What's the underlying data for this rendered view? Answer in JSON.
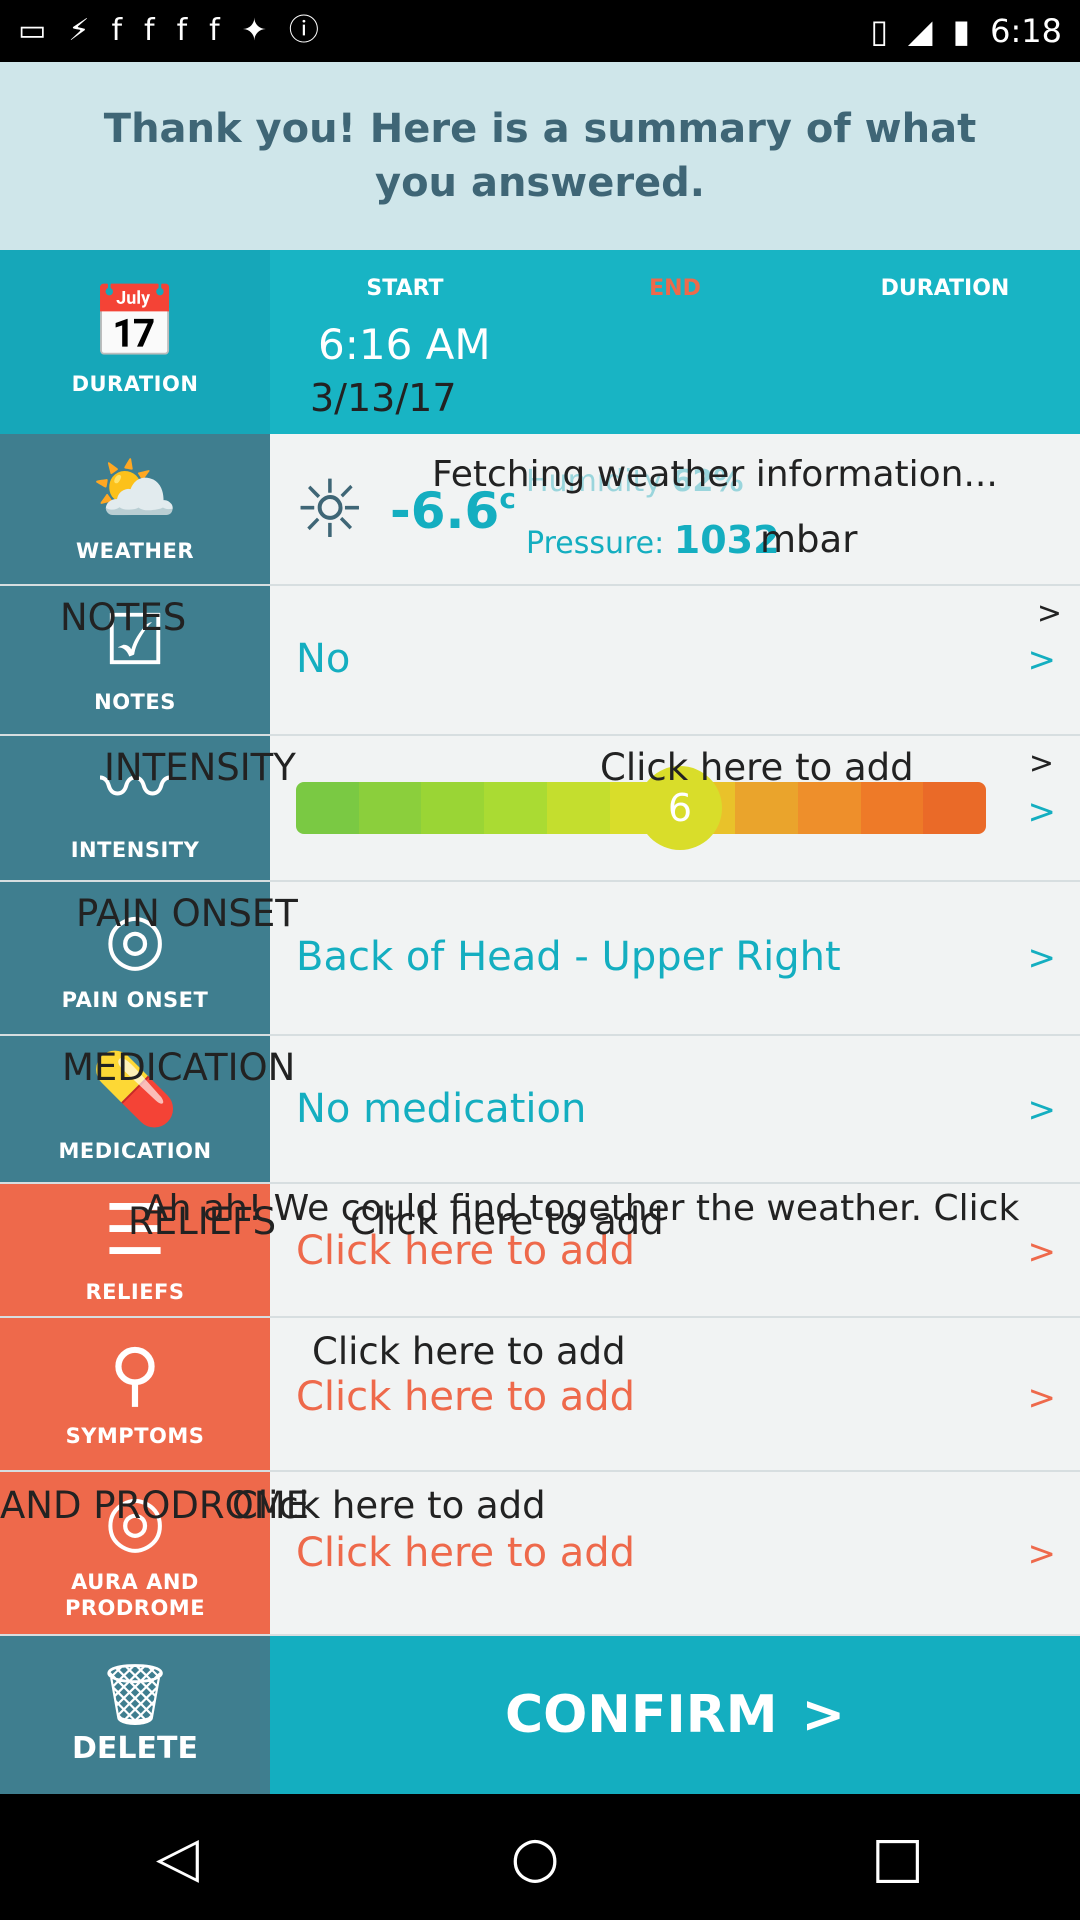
{
  "status": {
    "time": "6:18",
    "left_icons": [
      "message-icon",
      "flash-icon",
      "facebook-icon",
      "facebook-icon",
      "facebook-icon",
      "facebook-icon",
      "satellite-icon",
      "info-icon"
    ],
    "right_icons": [
      "vibrate-icon",
      "signal-icon",
      "battery-icon"
    ]
  },
  "header": {
    "title": "Thank you! Here is a summary of what you answered."
  },
  "duration": {
    "label": "DURATION",
    "col_start": "START",
    "col_end": "END",
    "col_duration": "DURATION",
    "start_time": "6:16 AM",
    "start_date": "3/13/17"
  },
  "weather": {
    "label": "WEATHER",
    "fetching": "Fetching weather information...",
    "temp": "-6.6",
    "temp_unit": "c",
    "humidity_label": "Humidity",
    "humidity_value": "62%",
    "pressure_label": "Pressure:",
    "pressure_value": "1032",
    "pressure_unit": "mbar"
  },
  "notes": {
    "label": "NOTES",
    "overlay_label": "NOTES",
    "value": "No"
  },
  "intensity": {
    "label": "INTENSITY",
    "overlay_label": "INTENSITY",
    "overlay_add": "Click here to add",
    "value": 6,
    "colors": [
      "#7ac943",
      "#8bcf3c",
      "#9ad535",
      "#aadb33",
      "#c4de2e",
      "#d9dd2a",
      "#e9c22a",
      "#eaa42c",
      "#ee8f2b",
      "#ee7a28",
      "#ea6a28"
    ]
  },
  "onset": {
    "label": "PAIN ONSET",
    "overlay_label": "PAIN ONSET",
    "value": "Back of Head - Upper Right"
  },
  "medication": {
    "label": "MEDICATION",
    "overlay_label": "MEDICATION",
    "value": "No medication"
  },
  "reliefs": {
    "label": "RELIEFS",
    "overlay_label": "RELIEFS",
    "overlay_msg": "Ah ah! We could find together the weather. Click",
    "overlay_add": "Click here to add",
    "value": "Click here to add"
  },
  "symptoms": {
    "label": "SYMPTOMS",
    "overlay_add": "Click here to add",
    "value": "Click here to add"
  },
  "aura": {
    "label": "AURA AND PRODROME",
    "label_line1": "AURA AND",
    "label_line2": "PRODROME",
    "overlay_label": "AND PRODROME",
    "overlay_add": "Click here to add",
    "value": "Click here to add"
  },
  "chevron": ">",
  "bottom": {
    "delete_label": "DELETE",
    "confirm_label": "CONFIRM",
    "confirm_chevron": ">"
  },
  "colors": {
    "teal": "#14aec0",
    "dark_teal": "#3f7e8f",
    "orange": "#ee694b"
  }
}
